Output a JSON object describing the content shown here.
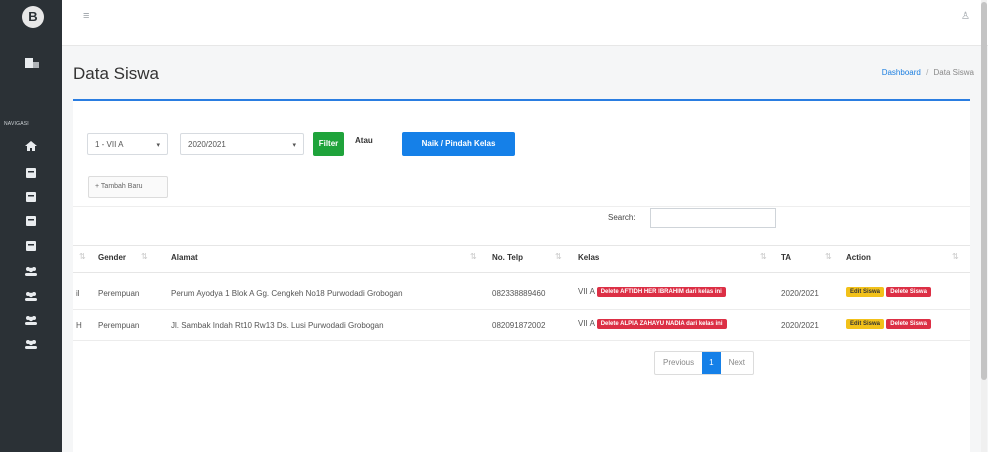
{
  "sidebar": {
    "logo_letter": "B",
    "section_label": "NAVIGASI",
    "icons": [
      "home-icon",
      "book-icon",
      "book-icon",
      "book-icon",
      "book-icon",
      "users-icon",
      "users-icon",
      "users-icon",
      "users-icon"
    ]
  },
  "topbar": {
    "menu_icon": "≡",
    "user_icon": "♙"
  },
  "header": {
    "title": "Data Siswa",
    "breadcrumb": {
      "link": "Dashboard",
      "sep": "/",
      "current": "Data Siswa"
    }
  },
  "filters": {
    "kelas_value": "1 - VII A",
    "tahun_value": "2020/2021",
    "filter_label": "Filter",
    "atau_label": "Atau",
    "naik_label": "Naik / Pindah Kelas",
    "tambah_label": "Tambah Baru"
  },
  "search": {
    "label": "Search:",
    "value": ""
  },
  "table": {
    "columns": [
      "Gender",
      "Alamat",
      "No. Telp",
      "Kelas",
      "TA",
      "Action"
    ],
    "rows": [
      {
        "cut": "il",
        "gender": "Perempuan",
        "alamat": "Perum Ayodya 1 Blok A Gg. Cengkeh No18 Purwodadi Grobogan",
        "telp": "082338889460",
        "kelas": "VII A",
        "kelas_badge": "Delete AFTIDH HER IBRAHIM dari kelas ini",
        "ta": "2020/2021",
        "edit": "Edit Siswa",
        "delete": "Delete Siswa"
      },
      {
        "cut": "H",
        "gender": "Perempuan",
        "alamat": "Jl. Sambak Indah Rt10 Rw13 Ds. Lusi Purwodadi Grobogan",
        "telp": "082091872002",
        "kelas": "VII A",
        "kelas_badge": "Delete ALPIA ZAHAYU NADIA dari kelas ini",
        "ta": "2020/2021",
        "edit": "Edit Siswa",
        "delete": "Delete Siswa"
      }
    ]
  },
  "pagination": {
    "previous": "Previous",
    "current": "1",
    "next": "Next"
  },
  "colors": {
    "primary": "#1580e8",
    "success": "#1fa33b",
    "danger": "#dc2f45",
    "warning": "#f2c11a",
    "sidebar": "#2b3136"
  }
}
